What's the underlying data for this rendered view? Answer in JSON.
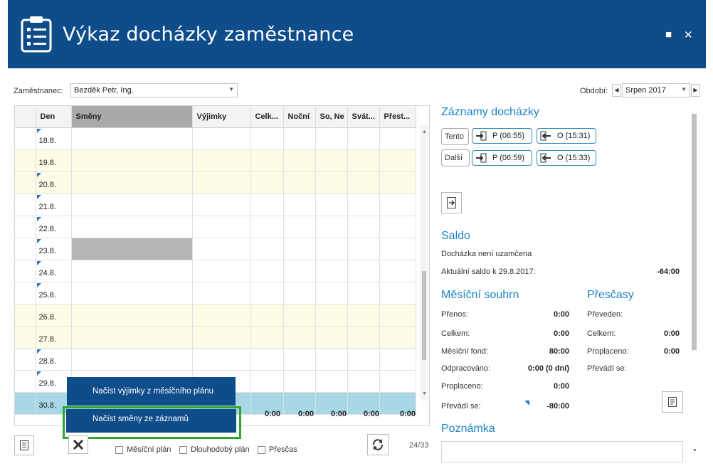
{
  "window": {
    "title": "Výkaz docházky zaměstnance",
    "icons": [
      "clipboard-list-icon",
      "maximize-icon",
      "close-icon"
    ],
    "maximize_glyph": "■",
    "close_glyph": "✕"
  },
  "colors": {
    "header": "#0f4c8a",
    "accent": "#1b84c6",
    "weekend_row": "#fdfce6",
    "selected_row": "#a8d8e6",
    "menu_highlight": "#2fa52f"
  },
  "employee": {
    "label": "Zaměstnanec:",
    "value": "Bezděk Petr, Ing."
  },
  "period": {
    "label": "Období:",
    "value": "Srpen 2017"
  },
  "grid": {
    "columns": [
      "Den",
      "Směny",
      "Výjimky",
      "Celk...",
      "Noční",
      "So, Ne",
      "Svát...",
      "Přest..."
    ],
    "rows": [
      {
        "day": "18.8.",
        "weekend": false,
        "marker": true,
        "shift_gray": false
      },
      {
        "day": "19.8.",
        "weekend": true,
        "marker": false,
        "shift_gray": false
      },
      {
        "day": "20.8.",
        "weekend": true,
        "marker": true,
        "shift_gray": false
      },
      {
        "day": "21.8.",
        "weekend": false,
        "marker": true,
        "shift_gray": false
      },
      {
        "day": "22.8.",
        "weekend": false,
        "marker": true,
        "shift_gray": false
      },
      {
        "day": "23.8.",
        "weekend": false,
        "marker": true,
        "shift_gray": true
      },
      {
        "day": "24.8.",
        "weekend": false,
        "marker": true,
        "shift_gray": false
      },
      {
        "day": "25.8.",
        "weekend": false,
        "marker": true,
        "shift_gray": false
      },
      {
        "day": "26.8.",
        "weekend": true,
        "marker": false,
        "shift_gray": false
      },
      {
        "day": "27.8.",
        "weekend": true,
        "marker": false,
        "shift_gray": false
      },
      {
        "day": "28.8.",
        "weekend": false,
        "marker": true,
        "shift_gray": false
      },
      {
        "day": "29.8.",
        "weekend": false,
        "marker": true,
        "shift_gray": false
      },
      {
        "day": "30.8.",
        "weekend": false,
        "marker": false,
        "shift_gray": false,
        "selected": true
      }
    ],
    "totals": [
      "0:00",
      "0:00",
      "0:00",
      "0:00",
      "0:00"
    ]
  },
  "context_menu": {
    "item1": "Načíst výjimky z měsíčního plánu",
    "item2": "Načíst směny ze záznamů"
  },
  "bottom": {
    "check_monthly": "Měsíční plán",
    "check_longterm": "Dlouhodobý plán",
    "check_overtime": "Přesčas",
    "pager": "24/33"
  },
  "records": {
    "title": "Záznamy docházky",
    "today_label": "Tento",
    "next_label": "Další",
    "today_in": "P (06:55)",
    "today_out": "O (15:31)",
    "next_in": "P (06:59)",
    "next_out": "O (15:33)"
  },
  "saldo": {
    "title": "Saldo",
    "status": "Docházka není uzamčena",
    "current_label": "Aktuální saldo k 29.8.2017:",
    "current_value": "-64:00"
  },
  "monthly": {
    "title": "Měsíční souhrn",
    "rows": [
      {
        "label": "Přenos:",
        "value": "0:00"
      },
      {
        "label": "Celkem:",
        "value": "0:00"
      },
      {
        "label": "Měsíční fond:",
        "value": "80:00"
      },
      {
        "label": "Odpracováno:",
        "value": "0:00 (0 dní)"
      },
      {
        "label": "Proplaceno:",
        "value": "0:00"
      },
      {
        "label": "Převádí se:",
        "value": "-80:00"
      }
    ]
  },
  "overtime": {
    "title": "Přesčasy",
    "rows": [
      {
        "label": "Převeden:",
        "value": ""
      },
      {
        "label": "Celkem:",
        "value": "0:00"
      },
      {
        "label": "Proplaceno:",
        "value": "0:00"
      },
      {
        "label": "Převádí se:",
        "value": ""
      }
    ]
  },
  "note": {
    "title": "Poznámka"
  }
}
